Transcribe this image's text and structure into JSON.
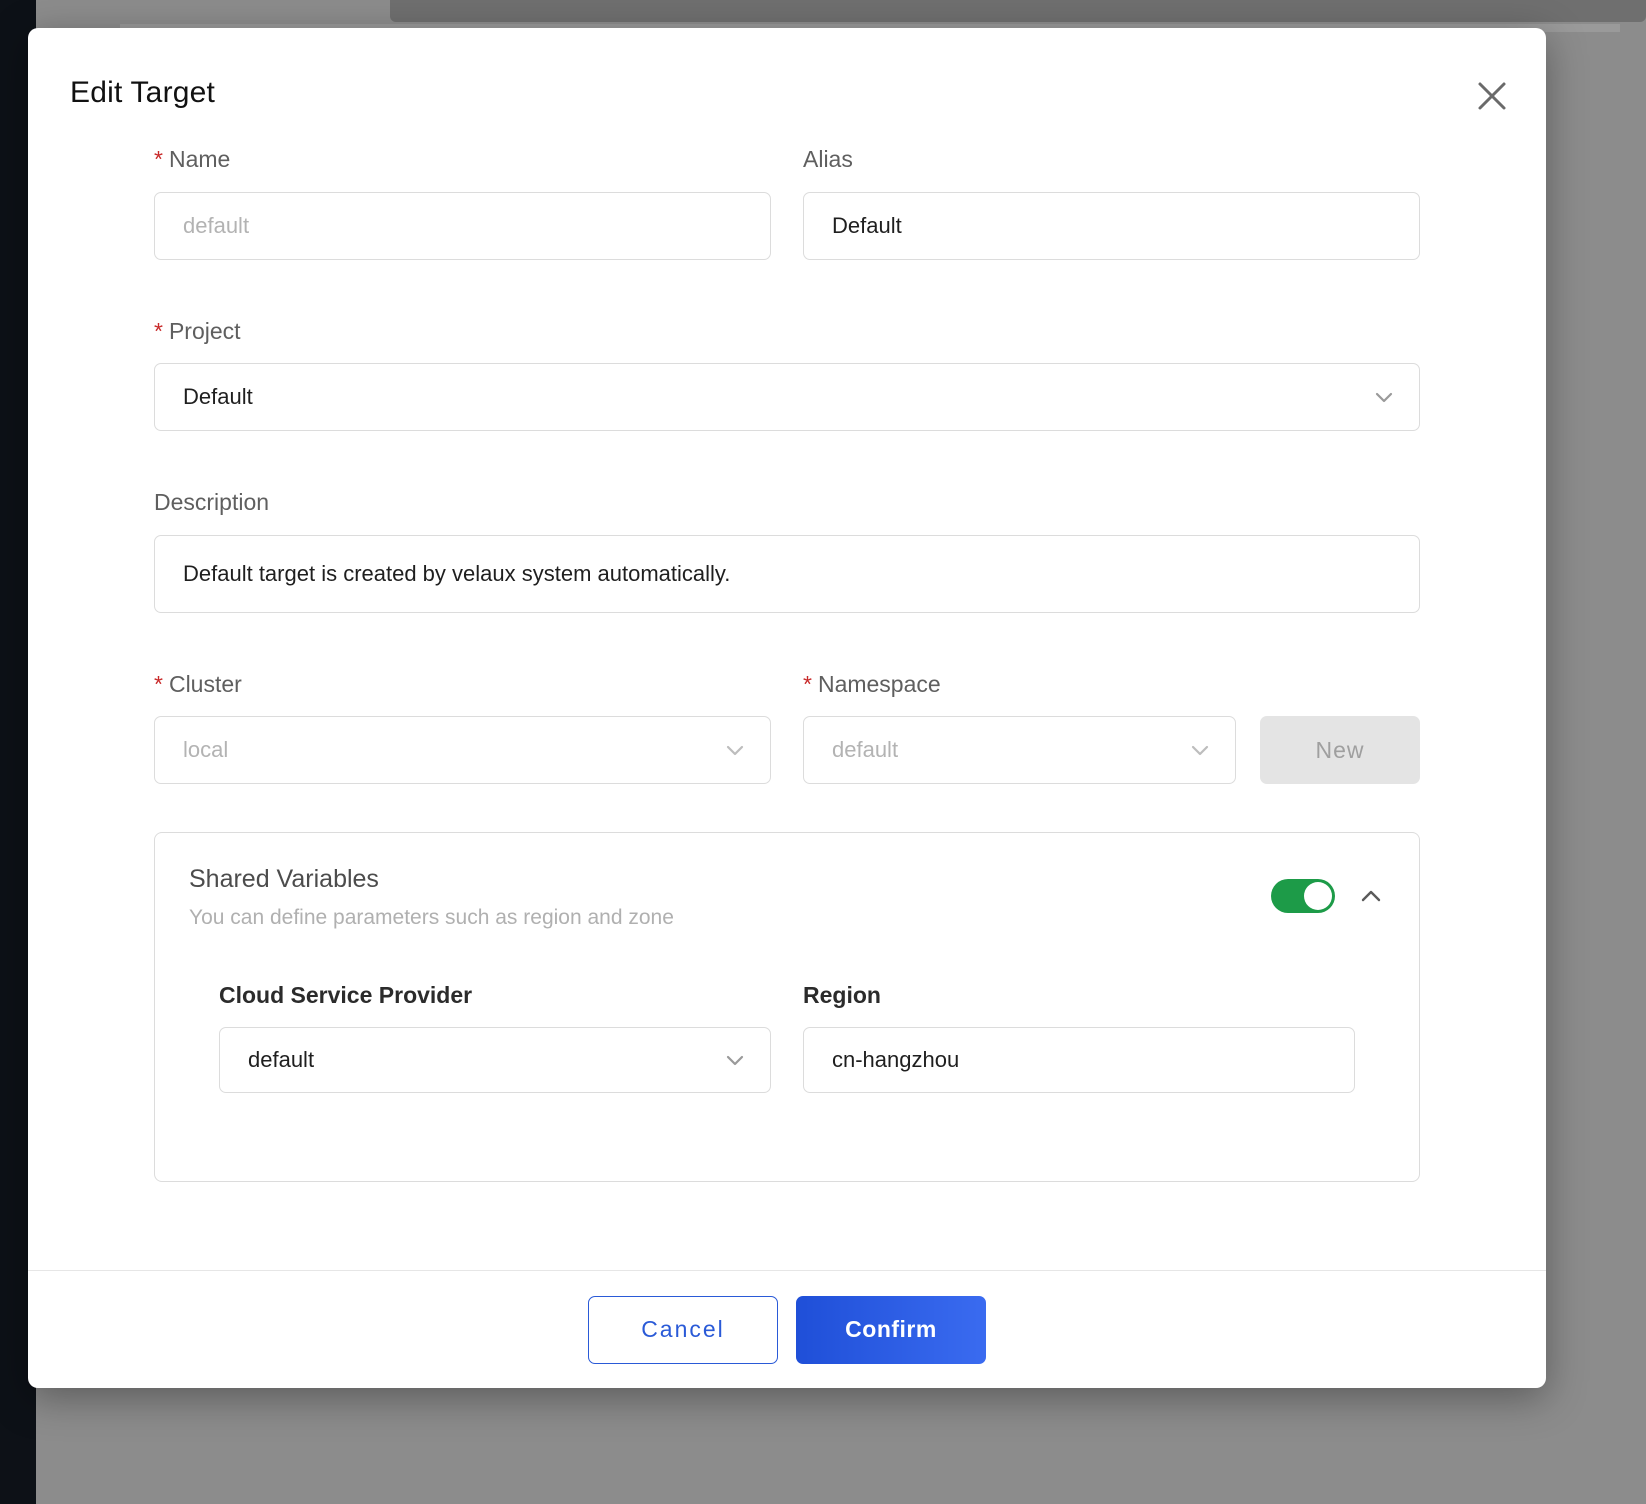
{
  "modal": {
    "title": "Edit Target",
    "close_icon": "close-icon"
  },
  "form": {
    "name": {
      "label": "Name",
      "required_marker": "*",
      "value": "",
      "placeholder": "default"
    },
    "alias": {
      "label": "Alias",
      "value": "Default",
      "placeholder": ""
    },
    "project": {
      "label": "Project",
      "required_marker": "*",
      "value": "Default",
      "chevron_icon": "chevron-down-icon"
    },
    "description": {
      "label": "Description",
      "value": "Default target is created by velaux system automatically."
    },
    "cluster": {
      "label": "Cluster",
      "required_marker": "*",
      "value": "local",
      "chevron_icon": "chevron-down-icon"
    },
    "namespace": {
      "label": "Namespace",
      "required_marker": "*",
      "value": "default",
      "chevron_icon": "chevron-down-icon"
    },
    "new_button": {
      "label": "New"
    }
  },
  "shared_variables": {
    "title": "Shared Variables",
    "subtitle": "You can define parameters such as region and zone",
    "toggle_on": true,
    "collapse_icon": "chevron-up-icon",
    "cloud_service_provider": {
      "label": "Cloud Service Provider",
      "value": "default",
      "chevron_icon": "chevron-down-icon"
    },
    "region": {
      "label": "Region",
      "value": "cn-hangzhou",
      "placeholder": ""
    }
  },
  "footer": {
    "cancel_label": "Cancel",
    "confirm_label": "Confirm"
  },
  "colors": {
    "required_red": "#c82a2a",
    "primary_blue": "#2a5ad7",
    "toggle_green": "#1d9b48",
    "disabled_grey": "#e4e4e4"
  }
}
